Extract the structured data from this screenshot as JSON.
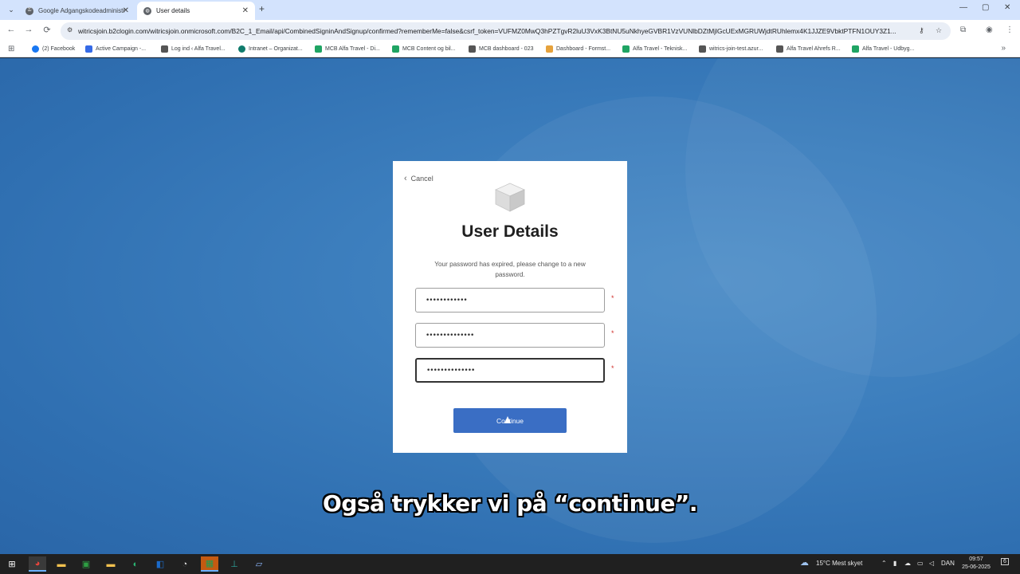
{
  "browser": {
    "tabs": [
      {
        "label": "Google Adgangskodeadministr",
        "active": false
      },
      {
        "label": "User details",
        "active": true
      }
    ],
    "new_tab": "+",
    "window_controls": {
      "minimize": "—",
      "maximize": "▢",
      "close": "✕"
    },
    "nav": {
      "back": "←",
      "forward": "→",
      "reload": "⟳"
    },
    "url": "witricsjoin.b2clogin.com/witricsjoin.onmicrosoft.com/B2C_1_Email/api/CombinedSigninAndSignup/confirmed?rememberMe=false&csrf_token=VUFMZ0MwQ3hPZTgvR2luU3VxK3BtNU5uNkhyeGVBR1VzVUNlbDZtMjlGcUExMGRUWjdtRUhlemx4K1JJZE9VbktPTFN1OUY3Z1...",
    "bookmarks": [
      {
        "label": "(2) Facebook",
        "color": "#1877f2"
      },
      {
        "label": "Active Campaign -...",
        "color": "#356ae6"
      },
      {
        "label": "Log ind ‹ Alfa Travel...",
        "color": "#555555"
      },
      {
        "label": "Intranet – Organizat...",
        "color": "#0f7b6c"
      },
      {
        "label": "MCB Alfa Travel - Di...",
        "color": "#1fa463"
      },
      {
        "label": "MCB Content og bil...",
        "color": "#1fa463"
      },
      {
        "label": "MCB dashboard - 023",
        "color": "#555555"
      },
      {
        "label": "Dashboard - Formst...",
        "color": "#e6a23c"
      },
      {
        "label": "Alfa Travel - Teknisk...",
        "color": "#1fa463"
      },
      {
        "label": "witrics-join-test.azur...",
        "color": "#555555"
      },
      {
        "label": "Alfa Travel Ahrefs R...",
        "color": "#555555"
      },
      {
        "label": "Alfa Travel - Udbyg...",
        "color": "#1fa463"
      }
    ]
  },
  "form": {
    "cancel_label": "Cancel",
    "title": "User Details",
    "message": "Your password has expired, please change to a new password.",
    "fields": [
      {
        "value": "••••••••••••",
        "required_mark": "*"
      },
      {
        "value": "••••••••••••••",
        "required_mark": "*"
      },
      {
        "value": "••••••••••••••",
        "required_mark": "*"
      }
    ],
    "continue_label": "Continue"
  },
  "subtitle": "Også trykker vi på “continue”.",
  "taskbar": {
    "weather": "15°C  Mest skyet",
    "language": "DAN",
    "time": "09:57",
    "date": "25-06-2025",
    "notifications": "6"
  },
  "colors": {
    "background": "#3d7fbe",
    "button": "#3a6ec4",
    "required": "#d0312d"
  }
}
